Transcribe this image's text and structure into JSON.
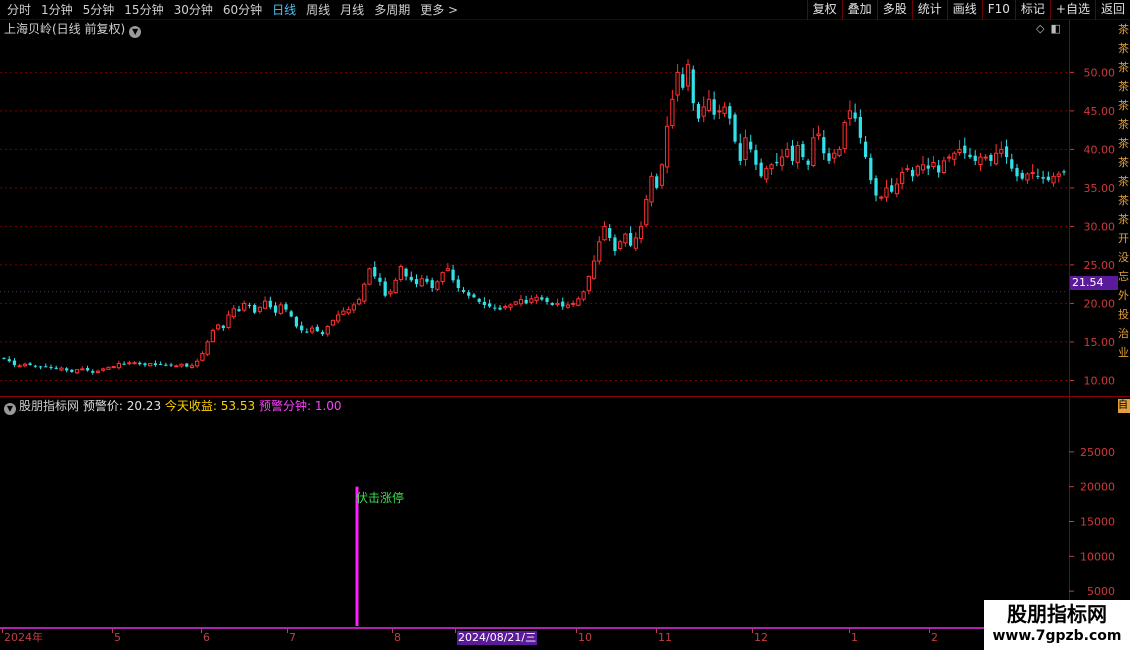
{
  "toolbar": {
    "periods": [
      {
        "label": "分时",
        "active": false
      },
      {
        "label": "1分钟",
        "active": false
      },
      {
        "label": "5分钟",
        "active": false
      },
      {
        "label": "15分钟",
        "active": false
      },
      {
        "label": "30分钟",
        "active": false
      },
      {
        "label": "60分钟",
        "active": false
      },
      {
        "label": "日线",
        "active": true
      },
      {
        "label": "周线",
        "active": false
      },
      {
        "label": "月线",
        "active": false
      },
      {
        "label": "多周期",
        "active": false
      },
      {
        "label": "更多 >",
        "active": false
      }
    ],
    "tools": [
      "复权",
      "叠加",
      "多股",
      "统计",
      "画线",
      "F10",
      "标记",
      "+自选",
      "返回"
    ]
  },
  "main_chart": {
    "title": "上海贝岭(日线 前复权)",
    "current_price_tag": "21.54",
    "right_strip": [
      "茶",
      "茶",
      "茶",
      "茶",
      "茶",
      "茶",
      "茶",
      "茶",
      "茶",
      "茶",
      "茶",
      "开",
      "没",
      "忘",
      "外",
      "投",
      "治",
      "业"
    ]
  },
  "indicator": {
    "name": "股朋指标网",
    "alert_price_label": "预警价:",
    "alert_price_value": "20.23",
    "today_profit_label": "今天收益:",
    "today_profit_value": "53.53",
    "alert_minute_label": "预警分钟:",
    "alert_minute_value": "1.00",
    "right_tag": "自",
    "signal_label": "伏击涨停"
  },
  "date_axis": {
    "labels": [
      "2024年",
      "5",
      "6",
      "7",
      "8",
      "2024/08/21/三",
      "10",
      "11",
      "12",
      "1",
      "2"
    ],
    "selected": "2024/08/21/三"
  },
  "watermark": {
    "line1": "股朋指标网",
    "line2": "www.7gpzb.com"
  },
  "colors": {
    "up": "#ff3030",
    "down": "#33dfe8",
    "grid": "#7a0000",
    "axis_text": "#cc3a3a",
    "accent": "#5a1a9a",
    "signal": "#ff20ff"
  },
  "chart_data": [
    {
      "type": "candlestick",
      "title": "上海贝岭(日线 前复权)",
      "ylim": [
        8.5,
        55.5
      ],
      "yticks": [
        10.0,
        15.0,
        20.0,
        25.0,
        30.0,
        35.0,
        40.0,
        45.0,
        50.0
      ],
      "ytick_labels": [
        "10.00",
        "15.00",
        "20.00",
        "25.00",
        "30.00",
        "35.00",
        "40.00",
        "45.00",
        "50.00"
      ],
      "current_price": 21.54,
      "grid": true,
      "xrange": [
        "2024-04",
        "2025-02"
      ],
      "closes": [
        12.8,
        12.5,
        12.0,
        11.9,
        12.1,
        12.0,
        11.8,
        11.7,
        11.8,
        11.6,
        11.5,
        11.6,
        11.3,
        11.1,
        11.4,
        11.5,
        11.3,
        11.0,
        11.2,
        11.5,
        11.7,
        11.8,
        12.2,
        12.1,
        12.3,
        12.3,
        12.1,
        12.0,
        12.2,
        12.0,
        12.1,
        12.0,
        12.0,
        11.9,
        12.1,
        11.8,
        11.9,
        12.5,
        13.5,
        15.0,
        16.5,
        17.2,
        16.8,
        18.5,
        19.3,
        19.0,
        20.0,
        19.8,
        18.8,
        19.5,
        20.3,
        19.5,
        18.8,
        19.8,
        19.2,
        18.3,
        17.0,
        16.5,
        16.3,
        16.8,
        16.4,
        16.0,
        17.0,
        17.8,
        18.5,
        19.0,
        19.2,
        19.8,
        20.5,
        22.5,
        24.5,
        23.5,
        22.8,
        21.0,
        21.5,
        23.0,
        24.8,
        23.5,
        23.0,
        22.5,
        23.2,
        22.8,
        22.0,
        22.8,
        24.0,
        24.5,
        23.0,
        22.0,
        21.5,
        21.0,
        20.8,
        20.2,
        19.8,
        19.6,
        19.4,
        19.2,
        19.6,
        19.8,
        20.2,
        20.5,
        20.0,
        20.6,
        20.8,
        20.5,
        20.2,
        19.8,
        20.0,
        19.6,
        19.8,
        20.0,
        20.6,
        21.5,
        23.5,
        25.5,
        28.0,
        30.0,
        28.5,
        26.8,
        28.0,
        29.0,
        27.5,
        28.5,
        30.0,
        33.5,
        36.5,
        35.0,
        38.0,
        43.0,
        46.5,
        50.0,
        48.0,
        51.0,
        46.0,
        44.0,
        45.5,
        46.5,
        44.5,
        45.0,
        45.5,
        44.0,
        41.0,
        38.5,
        41.5,
        40.0,
        38.0,
        36.5,
        37.5,
        38.0,
        38.2,
        39.0,
        40.0,
        38.5,
        40.5,
        39.0,
        38.0,
        41.5,
        42.0,
        39.5,
        38.5,
        39.5,
        40.0,
        43.5,
        45.0,
        44.0,
        41.5,
        39.0,
        36.0,
        34.0,
        33.8,
        35.0,
        34.5,
        35.5,
        37.0,
        37.5,
        36.5,
        37.8,
        38.0,
        37.5,
        38.3,
        37.0,
        38.5,
        39.0,
        39.5,
        40.0,
        39.5,
        39.0,
        38.5,
        39.0,
        39.0,
        38.5,
        39.5,
        40.0,
        39.0,
        37.5,
        36.5,
        36.2,
        36.8,
        37.0,
        36.5,
        36.2,
        36.0,
        36.5,
        36.8,
        37.0
      ]
    },
    {
      "type": "bar",
      "series_label": "伏击涨停",
      "ylim": [
        0,
        30000
      ],
      "yticks": [
        5000,
        10000,
        15000,
        20000,
        25000
      ],
      "ytick_labels": [
        "5000",
        "10000",
        "15000",
        "20000",
        "25000"
      ],
      "x": [
        "2024-08-21"
      ],
      "values": [
        20000
      ]
    }
  ]
}
